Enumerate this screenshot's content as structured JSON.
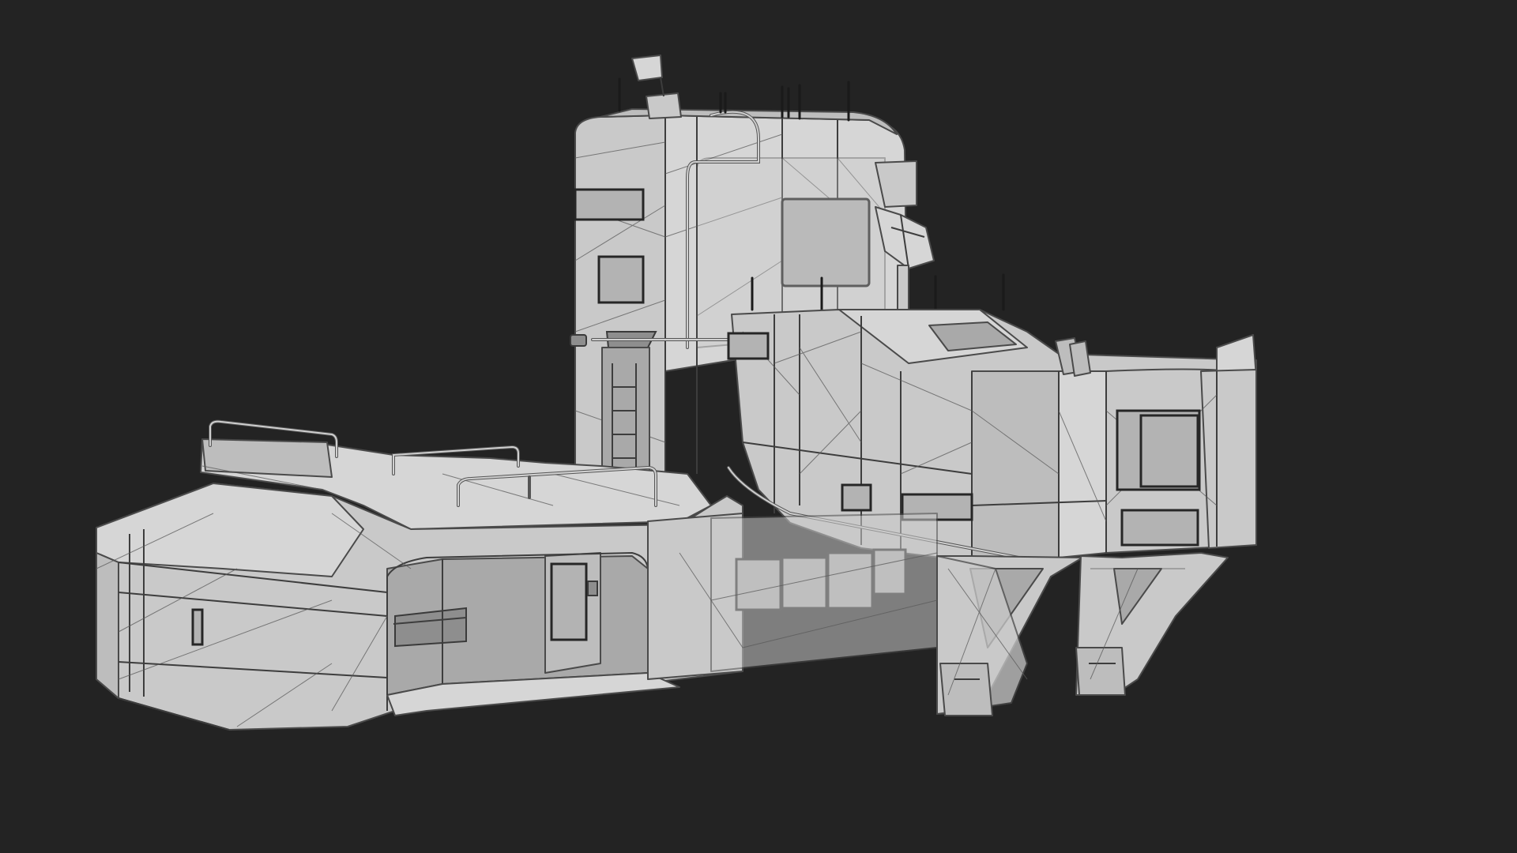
{
  "scene": {
    "background_color": "#232323",
    "model_base_color": "#c9c9c9",
    "wireframe_color": "#4a4a4a",
    "render_style": "clay-wireframe"
  }
}
